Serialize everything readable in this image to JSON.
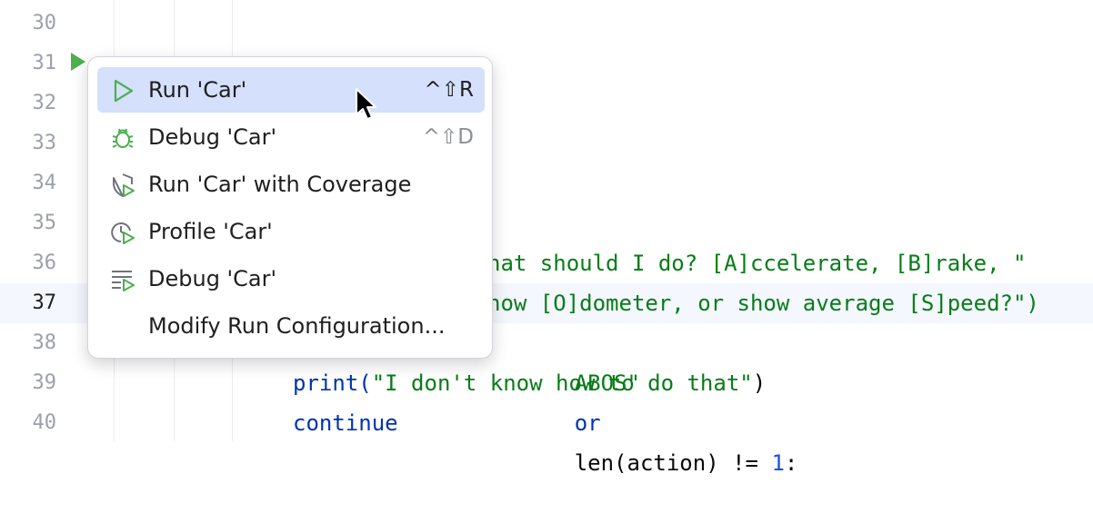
{
  "editor": {
    "lines": [
      {
        "num": "30"
      },
      {
        "num": "31"
      },
      {
        "num": "32"
      },
      {
        "num": "33"
      },
      {
        "num": "34"
      },
      {
        "num": "35"
      },
      {
        "num": "36",
        "code_tail": "hat should I do? [A]ccelerate, [B]rake, \""
      },
      {
        "num": "37",
        "code_tail": "how [O]dometer, or show average [S]peed?\")"
      },
      {
        "num": "38",
        "code_s": "ABOS\"",
        "code_kw": "or",
        "code_mid": "len(action) != ",
        "code_num": "1",
        "code_end": ":"
      },
      {
        "num": "39",
        "code_fn": "print(",
        "code_str": "\"I don't know how to do that\"",
        "code_end": ")"
      },
      {
        "num": "40",
        "code_kw": "continue"
      }
    ],
    "active_line": "37"
  },
  "gutter": {
    "run_icon": "run-triangle-icon",
    "run_color": "#4caf50"
  },
  "popup_menu": {
    "items": [
      {
        "label": "Run 'Car'",
        "shortcut": "^⇧R",
        "icon": "run-icon",
        "selected": true
      },
      {
        "label": "Debug 'Car'",
        "shortcut": "^⇧D",
        "icon": "debug-bug-icon",
        "selected": false
      },
      {
        "label": "Run 'Car' with Coverage",
        "shortcut": "",
        "icon": "coverage-shield-icon",
        "selected": false
      },
      {
        "label": "Profile 'Car'",
        "shortcut": "",
        "icon": "profile-clock-icon",
        "selected": false
      },
      {
        "label": "Debug 'Car'",
        "shortcut": "",
        "icon": "debug-lines-icon",
        "selected": false
      },
      {
        "label": "Modify Run Configuration...",
        "shortcut": "",
        "icon": "",
        "selected": false
      }
    ],
    "accent_color": "#d5e0fc",
    "icon_color": "#4caf50"
  }
}
